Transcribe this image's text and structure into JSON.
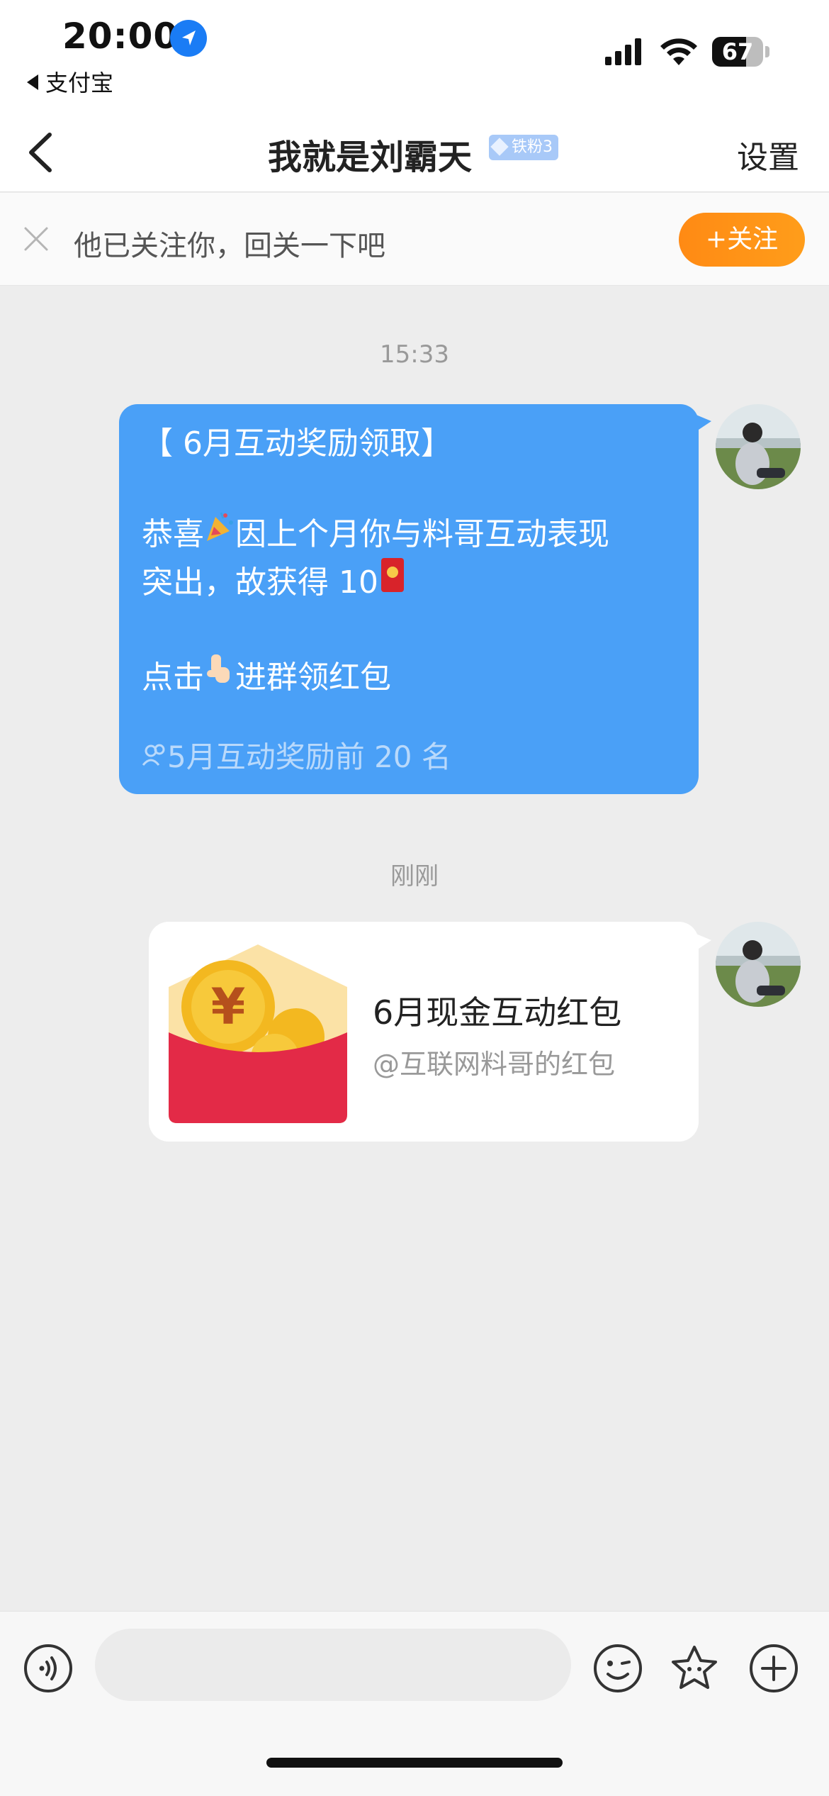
{
  "status_bar": {
    "time": "20:00",
    "back_app": "支付宝",
    "battery": "67",
    "battery_level": 0.67
  },
  "header": {
    "title": "我就是刘霸天",
    "badge": "铁粉3",
    "settings": "设置"
  },
  "follow_bar": {
    "text": "他已关注你，回关一下吧",
    "button": "+关注"
  },
  "chat": {
    "timestamp_1": "15:33",
    "message_1": {
      "line1": "【 6月互动奖励领取】",
      "line2_a": "恭喜",
      "line2_b": "因上个月你与料哥互动表现",
      "line3": "突出，故获得 10",
      "line4_a": "点击",
      "line4_b": "进群领红包",
      "footer": "5月互动奖励前 20 名"
    },
    "timestamp_2": "刚刚",
    "red_packet": {
      "title": "6月现金互动红包",
      "subtitle": "@互联网料哥的红包"
    }
  },
  "colors": {
    "bubble_blue": "#4aa0f7",
    "follow_orange": "#ff8a14",
    "red_packet_red": "#e32a47",
    "background": "#ededed"
  }
}
